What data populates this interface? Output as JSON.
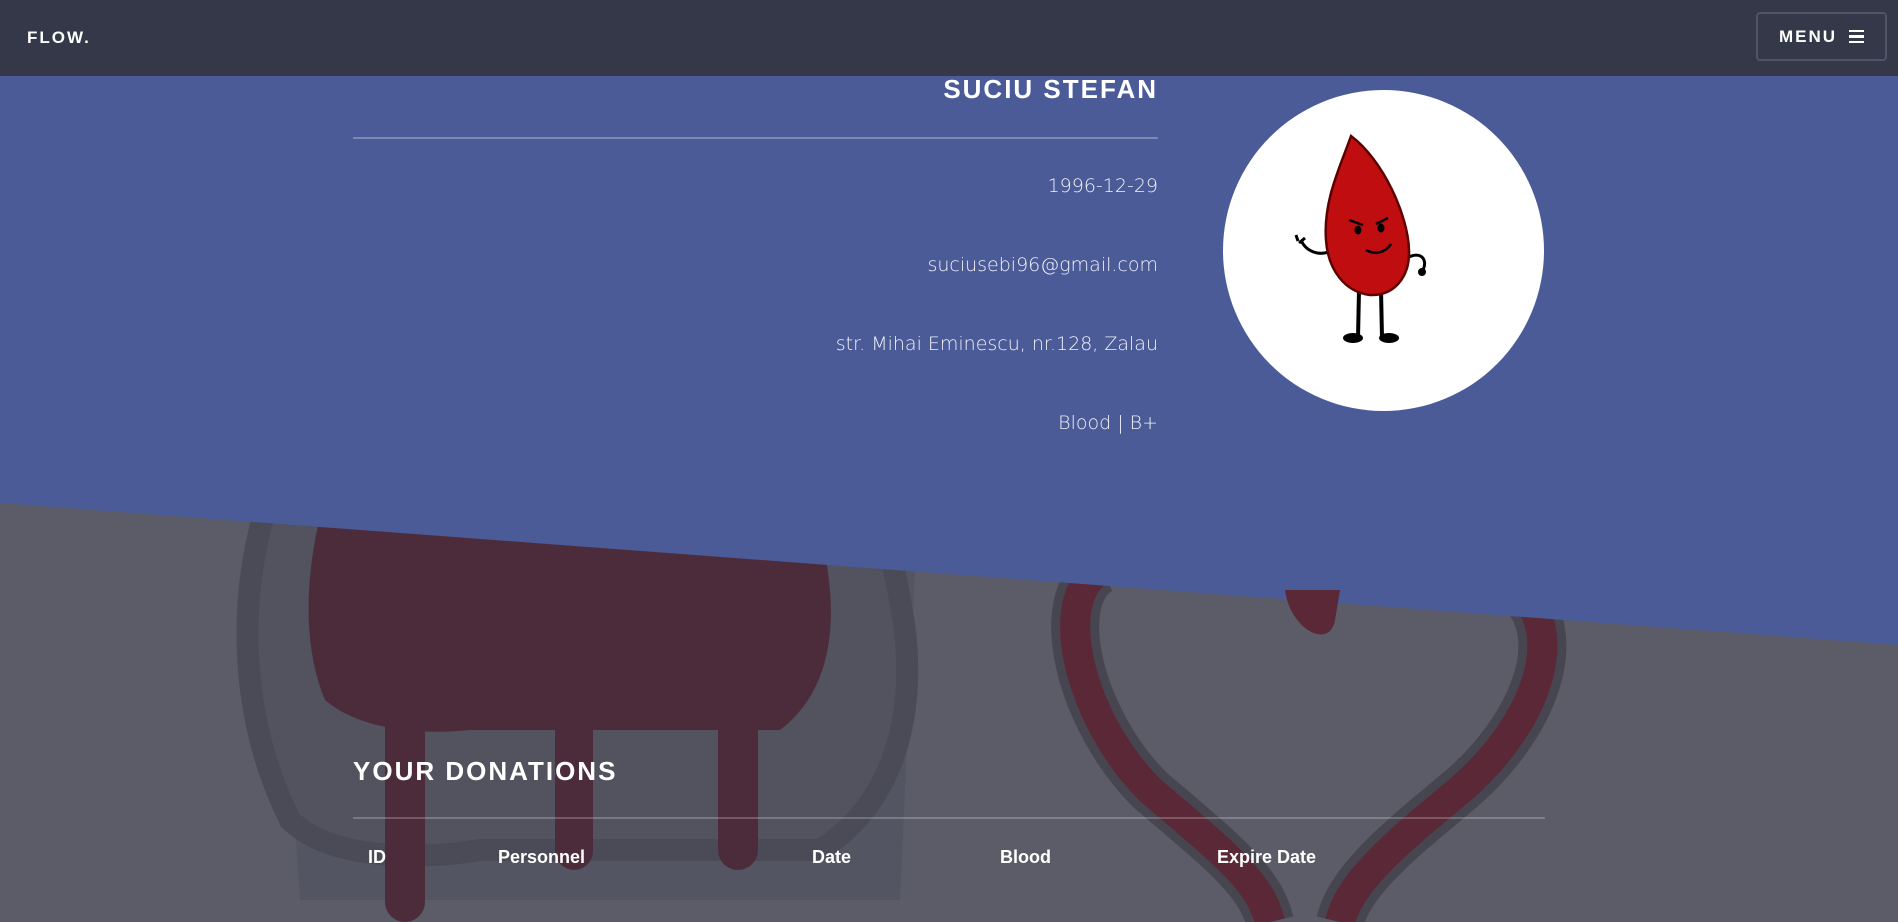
{
  "nav": {
    "logo": "FLOW.",
    "menu_label": "MENU"
  },
  "profile": {
    "name": "SUCIU STEFAN",
    "birth_date": "1996-12-29",
    "email": "suciusebi96@gmail.com",
    "address": "str. Mihai Eminescu, nr.128, Zalau",
    "blood": "Blood | B+"
  },
  "donations": {
    "title": "YOUR DONATIONS",
    "columns": [
      "ID",
      "Personnel",
      "Date",
      "Blood",
      "Expire Date"
    ]
  },
  "colors": {
    "topbar": "#343849",
    "hero": "#4b5b97",
    "page_bg": "#5b5c68",
    "blood_red": "#c00e10"
  }
}
